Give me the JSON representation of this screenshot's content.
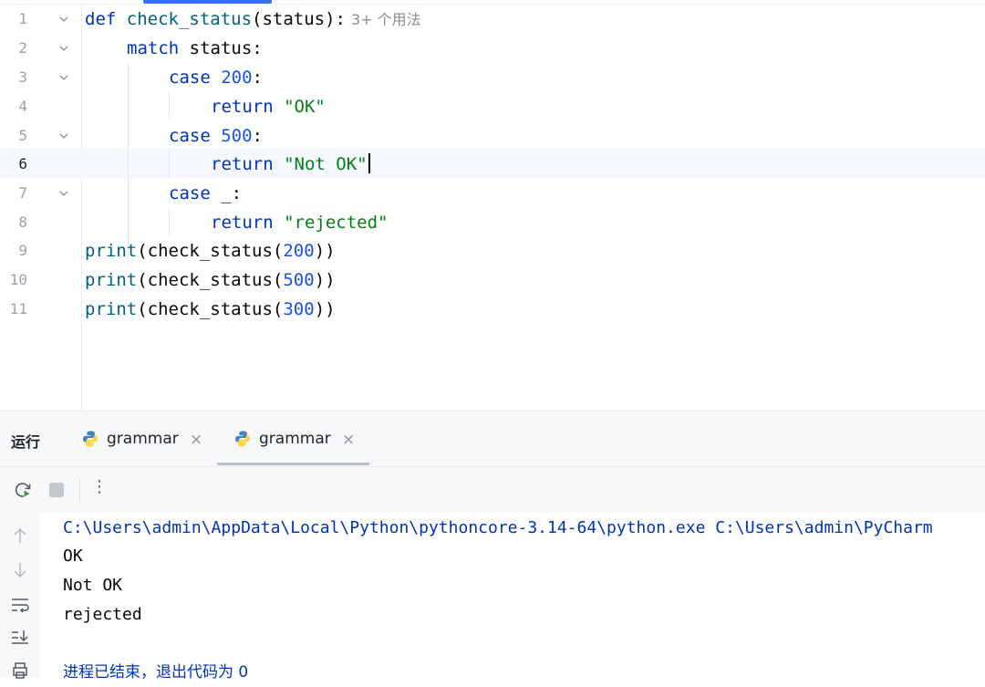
{
  "editor": {
    "usage_hint": "3+ 个用法",
    "lines": [
      {
        "n": "1",
        "tokens": [
          {
            "t": "def ",
            "c": "kw"
          },
          {
            "t": "check_status",
            "c": "fn"
          },
          {
            "t": "(status):",
            "c": ""
          }
        ]
      },
      {
        "n": "2",
        "tokens": [
          {
            "t": "match ",
            "c": "kw"
          },
          {
            "t": "status:",
            "c": ""
          }
        ]
      },
      {
        "n": "3",
        "tokens": [
          {
            "t": "case ",
            "c": "kw"
          },
          {
            "t": "200",
            "c": "num"
          },
          {
            "t": ":",
            "c": ""
          }
        ]
      },
      {
        "n": "4",
        "tokens": [
          {
            "t": "return ",
            "c": "kw"
          },
          {
            "t": "\"OK\"",
            "c": "str"
          }
        ]
      },
      {
        "n": "5",
        "tokens": [
          {
            "t": "case ",
            "c": "kw"
          },
          {
            "t": "500",
            "c": "num"
          },
          {
            "t": ":",
            "c": ""
          }
        ]
      },
      {
        "n": "6",
        "tokens": [
          {
            "t": "return ",
            "c": "kw"
          },
          {
            "t": "\"Not OK\"",
            "c": "str"
          }
        ]
      },
      {
        "n": "7",
        "tokens": [
          {
            "t": "case ",
            "c": "kw"
          },
          {
            "t": "_:",
            "c": ""
          }
        ]
      },
      {
        "n": "8",
        "tokens": [
          {
            "t": "return ",
            "c": "kw"
          },
          {
            "t": "\"rejected\"",
            "c": "str"
          }
        ]
      },
      {
        "n": "9",
        "tokens": [
          {
            "t": "print",
            "c": "fn"
          },
          {
            "t": "(check_status(",
            "c": ""
          },
          {
            "t": "200",
            "c": "num"
          },
          {
            "t": "))",
            "c": ""
          }
        ]
      },
      {
        "n": "10",
        "tokens": [
          {
            "t": "print",
            "c": "fn"
          },
          {
            "t": "(check_status(",
            "c": ""
          },
          {
            "t": "500",
            "c": "num"
          },
          {
            "t": "))",
            "c": ""
          }
        ]
      },
      {
        "n": "11",
        "tokens": [
          {
            "t": "print",
            "c": "fn"
          },
          {
            "t": "(check_status(",
            "c": ""
          },
          {
            "t": "300",
            "c": "num"
          },
          {
            "t": "))",
            "c": ""
          }
        ]
      }
    ]
  },
  "run_panel": {
    "title": "运行",
    "tabs": [
      {
        "label": "grammar",
        "close": "×"
      },
      {
        "label": "grammar",
        "close": "×"
      }
    ],
    "toolbar": {
      "more": "⋮"
    },
    "console": {
      "command": "C:\\Users\\admin\\AppData\\Local\\Python\\pythoncore-3.14-64\\python.exe C:\\Users\\admin\\PyCharm",
      "output": [
        "OK",
        "Not OK",
        "rejected"
      ],
      "exit_message": "进程已结束，退出代码为 0"
    }
  },
  "icons": {
    "fold": "chevron-down-icon",
    "python_file": "python-icon",
    "rerun": "rerun-icon",
    "stop": "stop-icon",
    "scroll_up": "arrow-up-icon",
    "scroll_down": "arrow-down-icon",
    "soft_wrap": "soft-wrap-icon",
    "scroll_to_end": "scroll-to-end-icon",
    "print": "print-icon"
  },
  "colors": {
    "keyword": "#0033b3",
    "function": "#00627a",
    "number": "#1750eb",
    "string": "#067d17",
    "accent": "#3574f0",
    "current_line": "#f5f8fe"
  }
}
